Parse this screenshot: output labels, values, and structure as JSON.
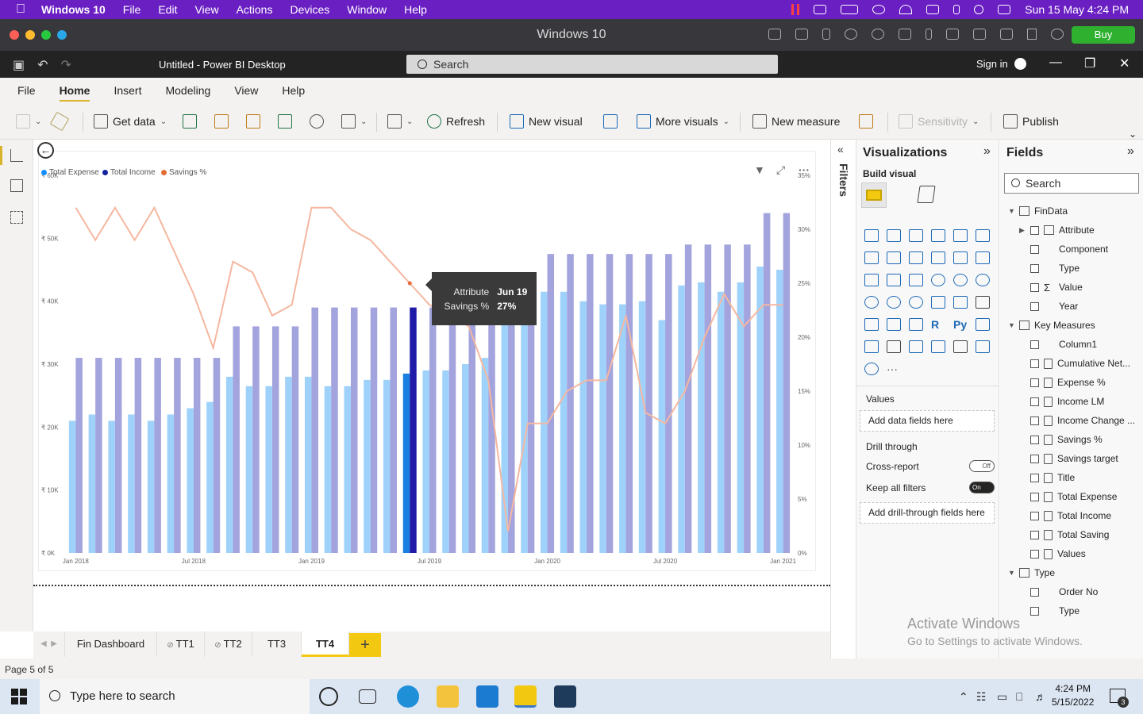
{
  "mac_menu": {
    "apple_glyph": "",
    "app_name": "Windows 10",
    "items": [
      "File",
      "Edit",
      "View",
      "Actions",
      "Devices",
      "Window",
      "Help"
    ],
    "datetime": "Sun 15 May  4:24 PM"
  },
  "vm_window": {
    "title": "Windows 10",
    "buy_label": "Buy"
  },
  "pbi_title": {
    "doc_title": "Untitled - Power BI Desktop",
    "search_label": "Search",
    "sign_in": "Sign in"
  },
  "ribbon_tabs": [
    "File",
    "Home",
    "Insert",
    "Modeling",
    "View",
    "Help"
  ],
  "ribbon": {
    "get_data": "Get data",
    "refresh": "Refresh",
    "new_visual": "New visual",
    "more_visuals": "More visuals",
    "new_measure": "New measure",
    "sensitivity": "Sensitivity",
    "publish": "Publish"
  },
  "legend": [
    {
      "name": "Total Expense",
      "color": "#118dff"
    },
    {
      "name": "Total Income",
      "color": "#12239e"
    },
    {
      "name": "Savings %",
      "color": "#e66c37"
    }
  ],
  "tooltip": {
    "k1": "Attribute",
    "v1": "Jun 19",
    "k2": "Savings %",
    "v2": "27%"
  },
  "chart_data": {
    "type": "bar",
    "combo": "clustered column + line (secondary axis)",
    "categories": [
      "Jan 2018",
      "Feb 2018",
      "Mar 2018",
      "Apr 2018",
      "May 2018",
      "Jun 2018",
      "Jul 2018",
      "Aug 2018",
      "Sep 2018",
      "Oct 2018",
      "Nov 2018",
      "Dec 2018",
      "Jan 2019",
      "Feb 2019",
      "Mar 2019",
      "Apr 2019",
      "May 2019",
      "Jun 2019",
      "Jul 2019",
      "Aug 2019",
      "Sep 2019",
      "Oct 2019",
      "Nov 2019",
      "Dec 2019",
      "Jan 2020",
      "Feb 2020",
      "Mar 2020",
      "Apr 2020",
      "May 2020",
      "Jun 2020",
      "Jul 2020",
      "Aug 2020",
      "Sep 2020",
      "Oct 2020",
      "Nov 2020",
      "Dec 2020",
      "Jan 2021"
    ],
    "x_tick_labels": [
      "Jan 2018",
      "Jul 2018",
      "Jan 2019",
      "Jul 2019",
      "Jan 2020",
      "Jul 2020",
      "Jan 2021"
    ],
    "series": [
      {
        "name": "Total Expense",
        "axis": "left",
        "values": [
          21000,
          22000,
          21000,
          22000,
          21000,
          22000,
          23000,
          24000,
          28000,
          26500,
          26500,
          28000,
          28000,
          26500,
          26500,
          27500,
          27500,
          28500,
          29000,
          29000,
          30000,
          31000,
          38500,
          39000,
          41500,
          41500,
          40000,
          39500,
          39500,
          40000,
          37000,
          42500,
          43000,
          41500,
          43000,
          45500,
          45000
        ]
      },
      {
        "name": "Total Income",
        "axis": "left",
        "values": [
          31000,
          31000,
          31000,
          31000,
          31000,
          31000,
          31000,
          31000,
          36000,
          36000,
          36000,
          36000,
          39000,
          39000,
          39000,
          39000,
          39000,
          39000,
          39000,
          39000,
          39000,
          39000,
          39000,
          39000,
          47500,
          47500,
          47500,
          47500,
          47500,
          47500,
          47500,
          49000,
          49000,
          49000,
          49000,
          54000,
          54000
        ]
      },
      {
        "name": "Savings %",
        "axis": "right",
        "values": [
          32,
          29,
          32,
          29,
          32,
          28,
          24,
          19,
          27,
          26,
          22,
          23,
          32,
          32,
          30,
          29,
          27,
          25,
          23,
          22,
          21,
          16,
          2,
          12,
          12,
          15,
          16,
          16,
          22,
          13,
          12,
          15,
          20,
          24,
          21,
          23,
          23
        ]
      }
    ],
    "highlighted_category": "Jun 2019",
    "y_left_ticks": [
      "₹ 0K",
      "₹ 10K",
      "₹ 20K",
      "₹ 30K",
      "₹ 40K",
      "₹ 50K",
      "₹ 60K"
    ],
    "y_right_ticks": [
      "0%",
      "5%",
      "10%",
      "15%",
      "20%",
      "25%",
      "30%",
      "35%"
    ],
    "ylim_left": [
      0,
      60000
    ],
    "ylim_right": [
      0,
      35
    ],
    "xlabel": "",
    "ylabel": "",
    "title": ""
  },
  "page_tabs": [
    "Fin Dashboard",
    "TT1",
    "TT2",
    "TT3",
    "TT4"
  ],
  "add_page": "+",
  "status": "Page 5 of 5",
  "filters_label": "Filters",
  "viz_pane": {
    "title": "Visualizations",
    "build_visual": "Build visual",
    "values_label": "Values",
    "values_drop": "Add data fields here",
    "drill_through": "Drill through",
    "cross_report": "Cross-report",
    "cross_report_state": "Off",
    "keep_filters": "Keep all filters",
    "keep_filters_state": "On",
    "drill_drop": "Add drill-through fields here",
    "gallery_icon_r": "R",
    "gallery_icon_py": "Py",
    "gallery_more": "···"
  },
  "fields_pane": {
    "title": "Fields",
    "search": "Search",
    "tables": [
      {
        "name": "FinData",
        "fields": [
          "Attribute",
          "Component",
          "Type",
          "Value",
          "Year"
        ]
      },
      {
        "name": "Key Measures",
        "fields": [
          "Column1",
          "Cumulative Net...",
          "Expense %",
          "Income LM",
          "Income Change ...",
          "Savings %",
          "Savings target",
          "Title",
          "Total Expense",
          "Total Income",
          "Total Saving",
          "Values"
        ]
      },
      {
        "name": "Type",
        "fields": [
          "Order No",
          "Type"
        ]
      }
    ]
  },
  "watermark": {
    "line1": "Activate Windows",
    "line2": "Go to Settings to activate Windows."
  },
  "taskbar": {
    "search_placeholder": "Type here to search",
    "time": "4:24 PM",
    "date": "5/15/2022",
    "notif_count": "3"
  }
}
